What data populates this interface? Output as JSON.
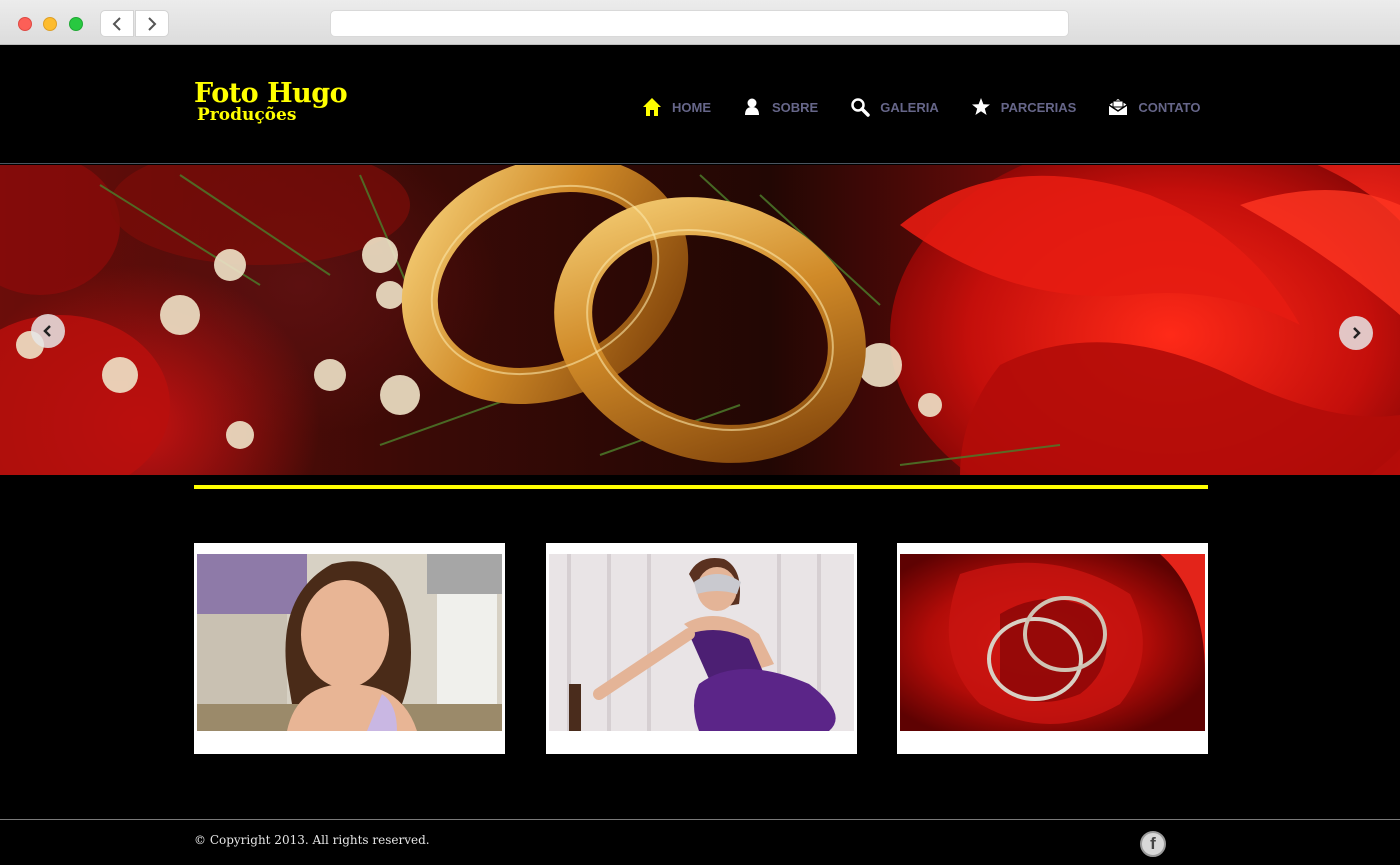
{
  "browser": {
    "back_icon": "chevron-left-icon",
    "forward_icon": "chevron-right-icon",
    "url": ""
  },
  "site": {
    "logo_title": "Foto Hugo",
    "logo_subtitle": "Produções",
    "brand_color": "#ffff00",
    "nav": [
      {
        "label": "HOME",
        "icon": "home-icon",
        "active": true
      },
      {
        "label": "SOBRE",
        "icon": "person-icon"
      },
      {
        "label": "GALERIA",
        "icon": "search-icon"
      },
      {
        "label": "PARCERIAS",
        "icon": "star-icon"
      },
      {
        "label": "CONTATO",
        "icon": "envelope-icon"
      }
    ],
    "nav_color": "#666689",
    "nav_active_icon_color": "#ffff00"
  },
  "slider": {
    "subject": "wedding rings on red roses",
    "prev_icon": "chevron-left-icon",
    "next_icon": "chevron-right-icon"
  },
  "gallery": [
    {
      "subject": "portrait of young girl"
    },
    {
      "subject": "girl in purple dress with masquerade mask"
    },
    {
      "subject": "wedding rings inside red rose"
    }
  ],
  "footer": {
    "copyright": "© Copyright 2013. All rights reserved.",
    "social_icon": "facebook-icon",
    "social_label": "f"
  }
}
